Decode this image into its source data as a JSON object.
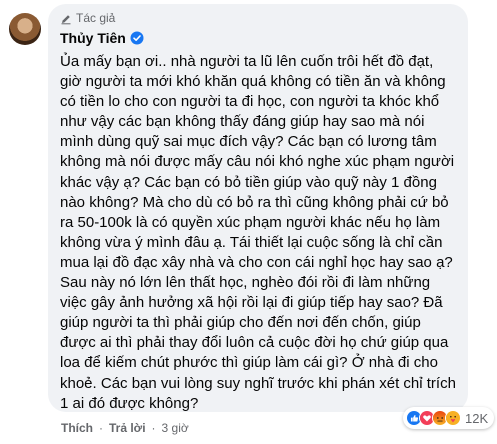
{
  "comment": {
    "author_tag": "Tác giả",
    "author_name": "Thủy Tiên",
    "text": "Ủa mấy bạn ơi.. nhà người ta lũ lên cuốn trôi hết đồ đạt, giờ người ta mới khó khăn quá không có tiền ăn và không có tiền lo cho con người ta đi học, con người ta khóc khổ như vậy các bạn không thấy đáng giúp hay sao mà nói mình dùng quỹ sai mục đích vậy? Các bạn có lương tâm không mà nói được mấy câu nói khó nghe xúc phạm người khác vậy ạ? Các bạn có bỏ tiền giúp vào quỹ này 1 đồng nào không? Mà cho dù có bỏ ra thì cũng không phải cứ bỏ ra 50-100k là có quyền xúc phạm người khác nếu họ làm không vừa ý mình đâu ạ. Tái thiết lại cuộc sống là chỉ cần mua lại đồ đạc xây nhà và cho con cái nghỉ học hay sao ạ? Sau này nó lớn lên thất học, nghèo đói rồi đi làm những việc gây ảnh hưởng xã hội rồi lại đi giúp tiếp hay sao? Đã giúp người ta thì phải giúp cho đến nơi đến chốn, giúp được ai thì phải thay đổi luôn cả cuộc đời họ chứ giúp qua loa để kiếm chút phước thì giúp làm cái gì? Ở nhà đi cho khoẻ. Các bạn vui lòng suy nghĩ trước khi phán xét chỉ trích 1 ai đó được không?",
    "reactions": {
      "icons": [
        "like-icon",
        "love-icon",
        "angry-icon",
        "care-icon"
      ],
      "count": "12K"
    },
    "actions": {
      "like": "Thích",
      "reply": "Trả lời",
      "time": "3 giờ",
      "separator": "·"
    }
  },
  "colors": {
    "bubble": "#f0f2f5",
    "text": "#050505",
    "muted": "#65676b",
    "verified": "#1877f2",
    "like": "#1877f2",
    "love": "#f33e58",
    "angry": "#e9710f",
    "care": "#f7b125"
  }
}
